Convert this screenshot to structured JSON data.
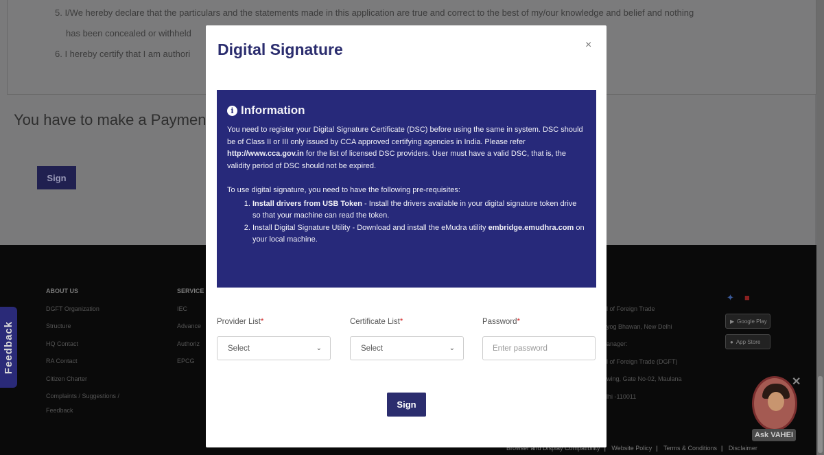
{
  "declarations": {
    "item5": "5. I/We hereby declare that the particulars and the statements made in this application are true and correct to the best of my/our knowledge and belief and nothing",
    "item5_cont": "has been concealed or withheld",
    "item6": "6. I hereby certify that I am authori"
  },
  "payment_message": "You have to make a Payment C",
  "background_sign_label": "Sign",
  "footer": {
    "about": {
      "heading": "ABOUT US",
      "items": [
        "DGFT Organization",
        "Structure",
        "HQ Contact",
        "RA Contact",
        "Citizen Charter",
        "Complaints / Suggestions /",
        "Feedback"
      ]
    },
    "services": {
      "heading": "SERVICE",
      "items": [
        "IEC",
        "Advance",
        "Authoriz",
        "EPCG"
      ]
    },
    "contact": {
      "items": [
        "l of Foreign Trade",
        "yog Bhawan, New Delhi",
        "anager:",
        "l of Foreign Trade (DGFT)",
        "wing, Gate No-02, Maulana",
        "lhi -110011"
      ]
    },
    "stores": {
      "google": "Google Play",
      "apple": "App Store"
    },
    "bottom_links": [
      "Browser and Display Compatibility",
      "Website Policy",
      "Terms & Conditions",
      "Disclaimer"
    ]
  },
  "feedback_tab": "Feedback",
  "assistant": {
    "label": "Ask VAHEI"
  },
  "modal": {
    "title": "Digital Signature",
    "close_label": "×",
    "info": {
      "heading": "Information",
      "p1_a": "You need to register your Digital Signature Certificate (DSC) before using the same in system. DSC should be of Class II or III only issued by CCA approved certifying agencies in India. Please refer ",
      "p1_link": "http://www.cca.gov.in",
      "p1_b": " for the list of licensed DSC providers. User must have a valid DSC, that is, the validity period of DSC should not be expired.",
      "prereq_intro": "To use digital signature, you need to have the following pre-requisites:",
      "step1_bold": "Install drivers from USB Token",
      "step1_rest": " - Install the drivers available in your digital signature token drive so that your machine can read the token.",
      "step2_a": "Install Digital Signature Utility - Download and install the eMudra utility ",
      "step2_bold": "embridge.emudhra.com",
      "step2_b": " on your local machine."
    },
    "provider_label": "Provider List",
    "certificate_label": "Certificate List",
    "password_label": "Password",
    "required_mark": "*",
    "provider_value": "Select",
    "certificate_value": "Select",
    "password_placeholder": "Enter password",
    "sign_label": "Sign"
  }
}
